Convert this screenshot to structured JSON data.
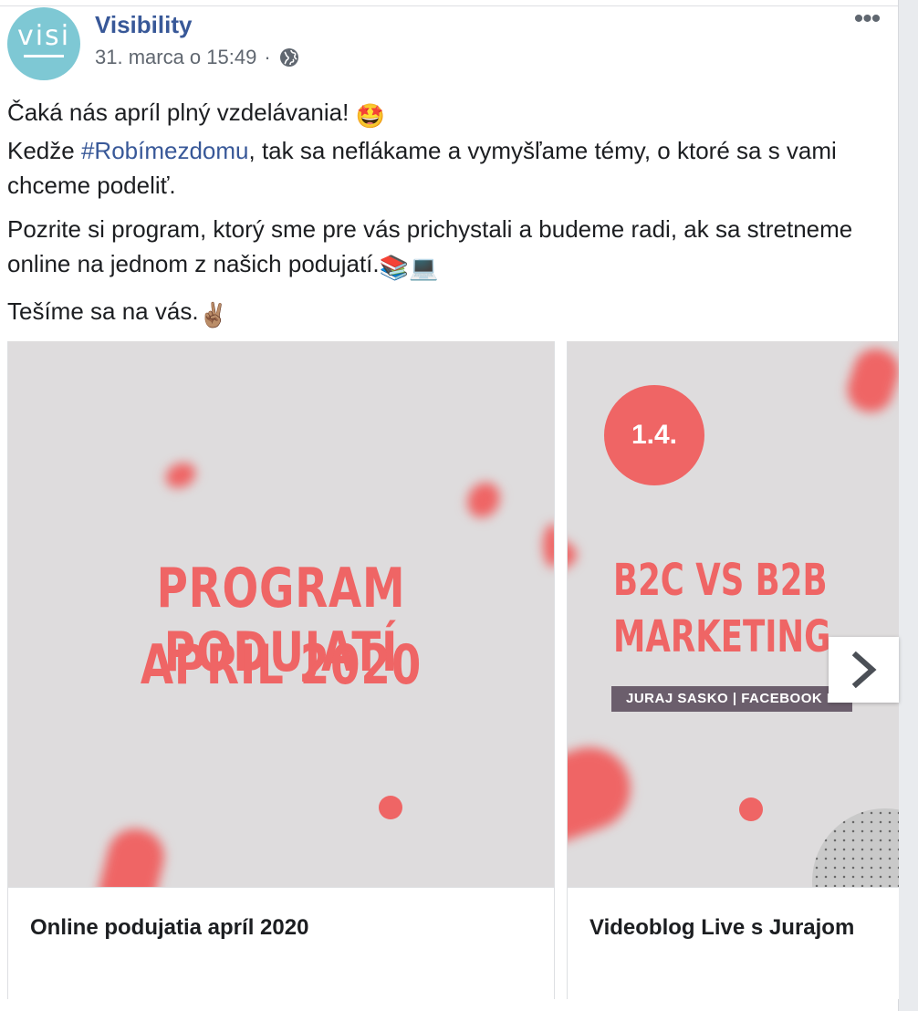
{
  "post": {
    "page_name": "Visibility",
    "avatar_text": "visi",
    "timestamp": "31. marca o 15:49",
    "separator": "·",
    "more_label": "•••",
    "icons": {
      "privacy": "globe-icon",
      "more": "more-options-icon"
    }
  },
  "text": {
    "line1": "Čaká nás apríl plný vzdelávania!",
    "line1_emoji": "🤩",
    "line2_prefix": "Kedže ",
    "hashtag": "#Robímezdomu",
    "line2_suffix": ", tak sa neflákame a vymyšľame témy, o ktoré sa s vami chceme podeliť.",
    "para2": "Pozrite si program, ktorý sme pre vás prichystali a budeme radi, ak sa stretneme online na jednom z našich podujatí.",
    "para2_emoji": "📚💻",
    "para3": "Tešíme sa na vás.",
    "para3_emoji": "✌🏽"
  },
  "carousel": {
    "cards": [
      {
        "image_line1": "PROGRAM PODUJATÍ",
        "image_line2": "APRÍL 2020",
        "caption": "Online podujatia apríl 2020"
      },
      {
        "date_badge": "1.4.",
        "image_line1": "B2C VS B2B",
        "image_line2": "MARKETING",
        "subbar": "JURAJ SASKO  |  FACEBOOK LIVE",
        "caption": "Videoblog Live s Jurajom"
      }
    ],
    "next_icon": "chevron-right-icon"
  },
  "colors": {
    "link": "#385898",
    "accent_red": "#ef6565",
    "image_bg": "#dedcdd",
    "subbar": "#6b5e6c",
    "avatar": "#7ec8d4"
  }
}
